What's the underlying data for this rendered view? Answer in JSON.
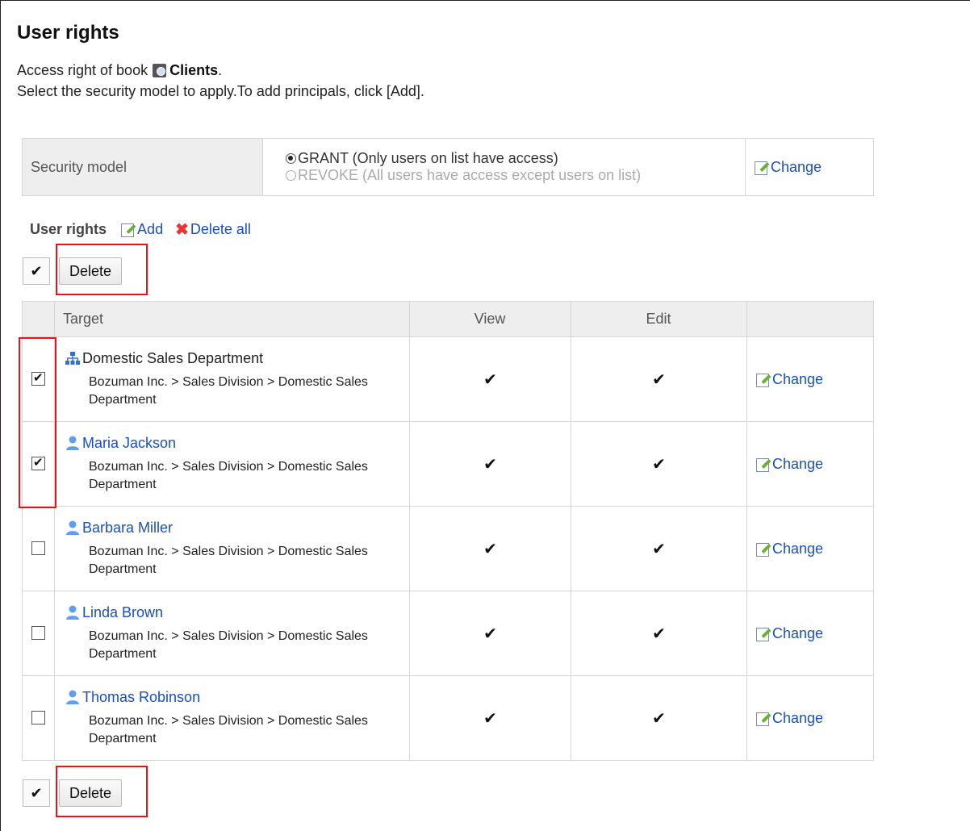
{
  "page": {
    "title": "User rights",
    "intro_prefix": "Access right of book",
    "book_name": "Clients",
    "intro_suffix": ".",
    "instruction": "Select the security model to apply.To add principals, click [Add]."
  },
  "security_model": {
    "label": "Security model",
    "options": [
      {
        "label": "GRANT (Only users on list have access)",
        "selected": true
      },
      {
        "label": "REVOKE (All users have access except users on list)",
        "selected": false
      }
    ],
    "change_label": "Change"
  },
  "user_rights": {
    "section_label": "User rights",
    "add_label": "Add",
    "delete_all_label": "Delete all",
    "check_all_glyph": "✔",
    "delete_label": "Delete",
    "columns": [
      "Target",
      "View",
      "Edit"
    ],
    "view_glyph": "✔",
    "edit_glyph": "✔",
    "rows": [
      {
        "name": "Domestic Sales Department",
        "type": "org",
        "path": "Bozuman Inc. > Sales Division > Domestic Sales Department",
        "checked": true,
        "view": true,
        "edit": true,
        "change_label": "Change"
      },
      {
        "name": "Maria Jackson",
        "type": "user",
        "path": "Bozuman Inc. > Sales Division > Domestic Sales Department",
        "checked": true,
        "view": true,
        "edit": true,
        "change_label": "Change"
      },
      {
        "name": "Barbara Miller",
        "type": "user",
        "path": "Bozuman Inc. > Sales Division > Domestic Sales Department",
        "checked": false,
        "view": true,
        "edit": true,
        "change_label": "Change"
      },
      {
        "name": "Linda Brown",
        "type": "user",
        "path": "Bozuman Inc. > Sales Division > Domestic Sales Department",
        "checked": false,
        "view": true,
        "edit": true,
        "change_label": "Change"
      },
      {
        "name": "Thomas Robinson",
        "type": "user",
        "path": "Bozuman Inc. > Sales Division > Domestic Sales Department",
        "checked": false,
        "view": true,
        "edit": true,
        "change_label": "Change"
      }
    ]
  },
  "icons": {
    "book": "address-book-icon",
    "edit": "edit-note-icon",
    "delete": "red-x-icon",
    "user": "user-icon",
    "org": "org-chart-icon"
  },
  "colors": {
    "link": "#1a4fc0",
    "highlight": "#e8141c",
    "header_bg": "#eeeeee"
  }
}
